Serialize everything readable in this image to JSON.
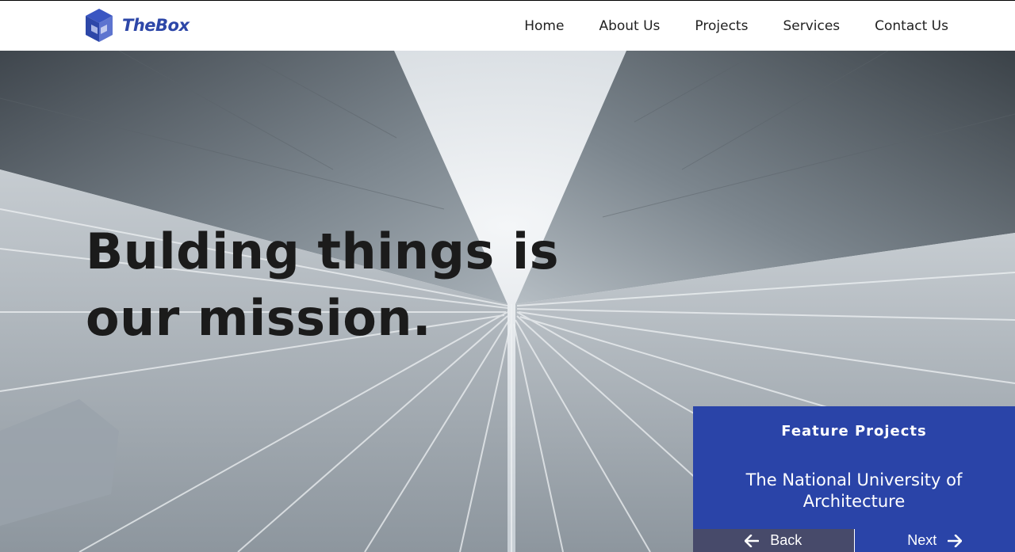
{
  "brand": {
    "name": "TheBox",
    "logo_icon": "cube-icon",
    "color": "#2d47a8"
  },
  "nav": {
    "items": [
      {
        "label": "Home"
      },
      {
        "label": "About Us"
      },
      {
        "label": "Projects"
      },
      {
        "label": "Services"
      },
      {
        "label": "Contact Us"
      }
    ]
  },
  "hero": {
    "headline_line1": "Bulding things is",
    "headline_line2": "our mission."
  },
  "feature": {
    "heading": "Feature Projects",
    "title": "The National University of Architecture",
    "back_label": "Back",
    "next_label": "Next",
    "back_icon": "arrow-left-icon",
    "next_icon": "arrow-right-icon",
    "accent_color": "#2a44a8",
    "back_color": "#474a6a"
  }
}
